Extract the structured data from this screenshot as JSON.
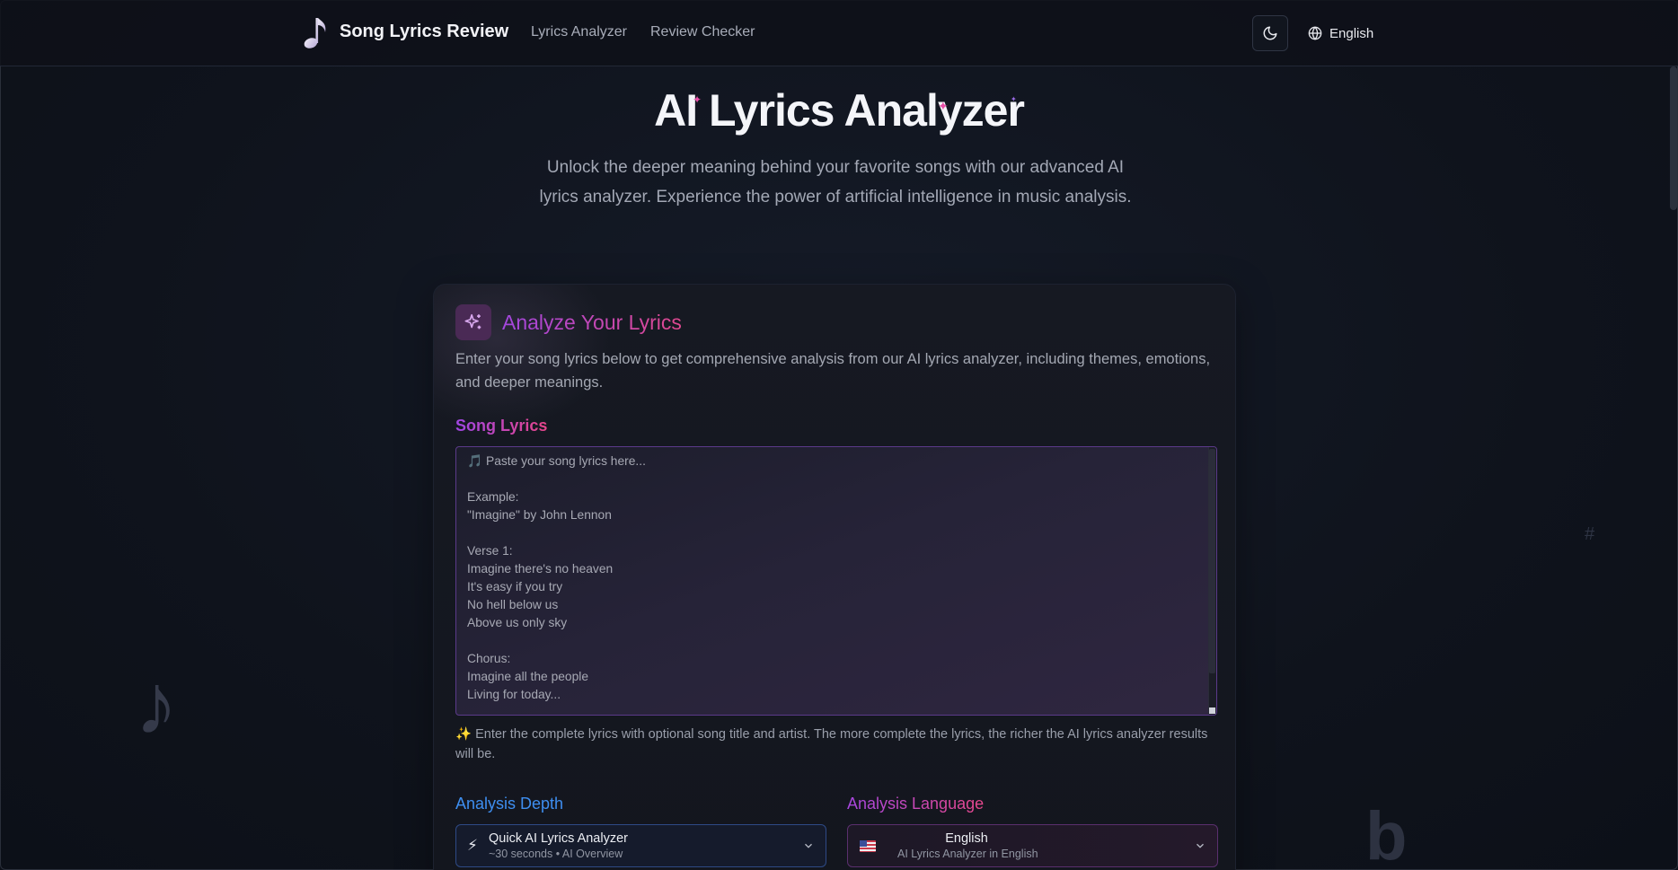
{
  "header": {
    "brand": "Song Lyrics Review",
    "nav": [
      "Lyrics Analyzer",
      "Review Checker"
    ],
    "language": "English",
    "icons": {
      "logo": "music-note-icon",
      "theme": "moon-icon",
      "language": "globe-icon"
    }
  },
  "hero": {
    "title": "AI Lyrics Analyzer",
    "subtitle": "Unlock the deeper meaning behind your favorite songs with our advanced AI lyrics analyzer. Experience the power of artificial intelligence in music analysis."
  },
  "card": {
    "title": "Analyze Your Lyrics",
    "description": "Enter your song lyrics below to get comprehensive analysis from our AI lyrics analyzer, including themes, emotions, and deeper meanings.",
    "lyrics_label": "Song Lyrics",
    "lyrics_placeholder": [
      "🎵 Paste your song lyrics here...",
      "",
      "Example:",
      "\"Imagine\" by John Lennon",
      "",
      "Verse 1:",
      "Imagine there's no heaven",
      "It's easy if you try",
      "No hell below us",
      "Above us only sky",
      "",
      "Chorus:",
      "Imagine all the people",
      "Living for today..."
    ],
    "helper": "✨ Enter the complete lyrics with optional song title and artist. The more complete the lyrics, the richer the AI lyrics analyzer results will be.",
    "depth_label": "Analysis Depth",
    "depth_value": "Quick AI Lyrics Analyzer",
    "depth_sub": "~30 seconds • AI Overview",
    "depth_icon": "⚡",
    "lang_label": "Analysis Language",
    "lang_value": "English",
    "lang_sub": "AI Lyrics Analyzer in English"
  },
  "decor": {
    "note": "♪",
    "sharp": "#",
    "flat": "b"
  },
  "colors": {
    "accent_purple": "#a347e0",
    "accent_pink": "#e0488f",
    "accent_blue": "#3e8ef0"
  }
}
